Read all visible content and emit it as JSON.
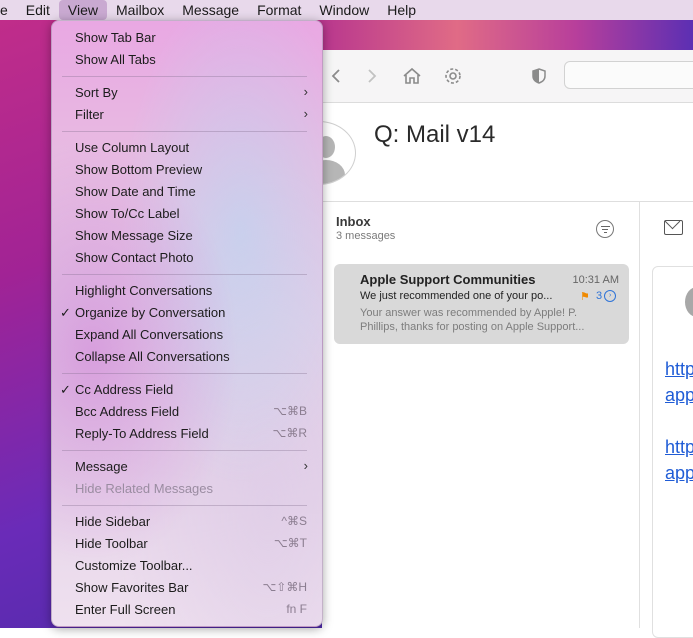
{
  "menubar": {
    "items": [
      "e",
      "Edit",
      "View",
      "Mailbox",
      "Message",
      "Format",
      "Window",
      "Help"
    ],
    "active": "View"
  },
  "toolbar": {
    "icons": [
      "chevron-left-icon",
      "chevron-right-icon",
      "home-icon",
      "gear-icon",
      "shield-icon"
    ]
  },
  "message_header": {
    "title": "Q:  Mail v14"
  },
  "mailbox": {
    "title": "Inbox",
    "count": "3 messages"
  },
  "message": {
    "sender": "Apple Support Communities",
    "time": "10:31 AM",
    "subject": "We just recommended one of your po...",
    "thread_count": "3",
    "preview": "Your answer was recommended by Apple! P. Phillips, thanks for posting on Apple Support..."
  },
  "reading_pane": {
    "links": [
      "https",
      "apple",
      "https",
      "apple"
    ]
  },
  "view_menu": {
    "show_tab_bar": "Show Tab Bar",
    "show_all_tabs": "Show All Tabs",
    "sort_by": "Sort By",
    "filter": "Filter",
    "use_column_layout": "Use Column Layout",
    "show_bottom_preview": "Show Bottom Preview",
    "show_date_and_time": "Show Date and Time",
    "show_to_cc_label": "Show To/Cc Label",
    "show_message_size": "Show Message Size",
    "show_contact_photo": "Show Contact Photo",
    "highlight_conversations": "Highlight Conversations",
    "organize_by_conversation": "Organize by Conversation",
    "expand_all_conversations": "Expand All Conversations",
    "collapse_all_conversations": "Collapse All Conversations",
    "cc_address_field": "Cc Address Field",
    "bcc_address_field": "Bcc Address Field",
    "bcc_shortcut": "⌥⌘B",
    "reply_to_address_field": "Reply-To Address Field",
    "reply_to_shortcut": "⌥⌘R",
    "message": "Message",
    "hide_related_messages": "Hide Related Messages",
    "hide_sidebar": "Hide Sidebar",
    "hide_sidebar_shortcut": "^⌘S",
    "hide_toolbar": "Hide Toolbar",
    "hide_toolbar_shortcut": "⌥⌘T",
    "customize_toolbar": "Customize Toolbar...",
    "show_favorites_bar": "Show Favorites Bar",
    "show_favorites_bar_shortcut": "⌥⇧⌘H",
    "enter_full_screen": "Enter Full Screen",
    "enter_full_screen_shortcut": "fn F",
    "checkmark": "✓",
    "submenu_arrow": "›"
  }
}
